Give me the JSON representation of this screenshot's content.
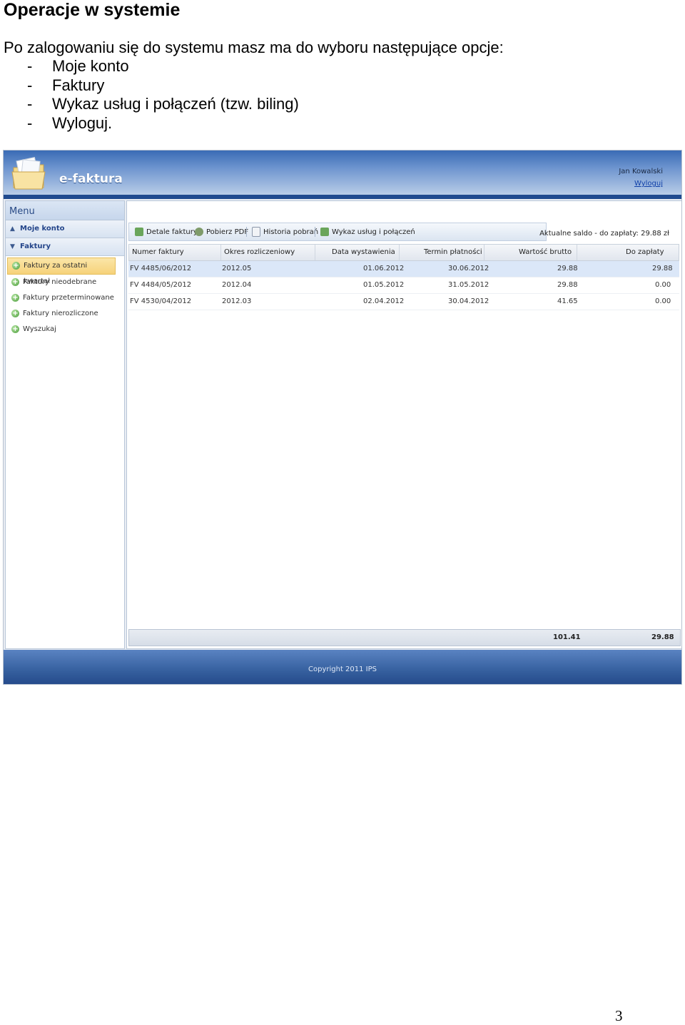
{
  "document": {
    "title": "Operacje w systemie",
    "intro": "Po zalogowaniu się do systemu masz ma do wyboru następujące opcje:",
    "list_marker": "-",
    "options": [
      "Moje konto",
      "Faktury",
      "Wykaz usług i połączeń (tzw. biling)",
      "Wyloguj."
    ],
    "page_number": "3"
  },
  "app": {
    "name": "e-faktura",
    "user": "Jan Kowalski",
    "logout": "Wyloguj",
    "copyright": "Copyright 2011 IPS"
  },
  "sidebar": {
    "menu_title": "Menu",
    "sections": [
      {
        "label": "Moje konto",
        "state": "collapsed"
      },
      {
        "label": "Faktury",
        "state": "expanded"
      }
    ],
    "items": [
      {
        "label": "Faktury za ostatni kwartał",
        "active": true
      },
      {
        "label": "Faktury nieodebrane",
        "active": false
      },
      {
        "label": "Faktury przeterminowane",
        "active": false
      },
      {
        "label": "Faktury nierozliczone",
        "active": false
      },
      {
        "label": "Wyszukaj",
        "active": false
      }
    ]
  },
  "toolbar": {
    "buttons": [
      {
        "label": "Detale faktury",
        "icon": "invoice-details-icon"
      },
      {
        "label": "Pobierz PDF",
        "icon": "download-pdf-icon"
      },
      {
        "label": "Historia pobrań",
        "icon": "history-icon"
      },
      {
        "label": "Wykaz usług i połączeń",
        "icon": "services-icon"
      }
    ],
    "balance": "Aktualne saldo - do zapłaty: 29.88 zł"
  },
  "table": {
    "columns": [
      "Numer faktury",
      "Okres rozliczeniowy",
      "Data wystawienia",
      "Termin płatności",
      "Wartość brutto",
      "Do zapłaty"
    ],
    "rows": [
      [
        "FV 4485/06/2012",
        "2012.05",
        "01.06.2012",
        "30.06.2012",
        "29.88",
        "29.88"
      ],
      [
        "FV 4484/05/2012",
        "2012.04",
        "01.05.2012",
        "31.05.2012",
        "29.88",
        "0.00"
      ],
      [
        "FV 4530/04/2012",
        "2012.03",
        "02.04.2012",
        "30.04.2012",
        "41.65",
        "0.00"
      ]
    ],
    "totals": {
      "gross": "101.41",
      "due": "29.88"
    }
  },
  "colors": {
    "header_blue": "#3a6bb5",
    "active_item": "#f6d27a",
    "selected_row": "#dbe7f8",
    "link": "#0f3fa8"
  }
}
